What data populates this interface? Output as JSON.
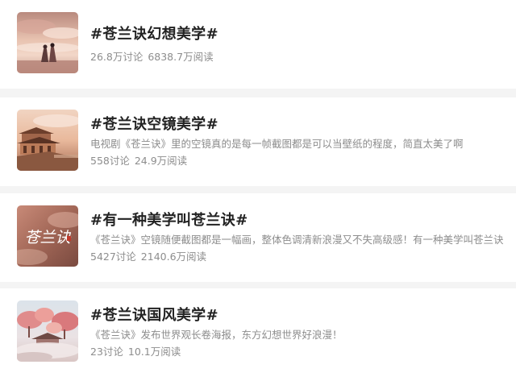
{
  "topics": [
    {
      "title": "#苍兰诀幻想美学#",
      "description": "",
      "discussions": "26.8万讨论",
      "reads": "6838.7万阅读",
      "thumbnail": "couple-under-sky-image"
    },
    {
      "title": "#苍兰诀空镜美学#",
      "description": "电视剧《苍兰诀》里的空镜真的是每一帧截图都是可以当壁纸的程度，简直太美了啊",
      "discussions": "558讨论",
      "reads": "24.9万阅读",
      "thumbnail": "palace-architecture-image"
    },
    {
      "title": "#有一种美学叫苍兰诀#",
      "description": "《苍兰诀》空镜随便截图都是一幅画，整体色调清新浪漫又不失高级感！有一种美学叫苍兰诀",
      "discussions": "5427讨论",
      "reads": "2140.6万阅读",
      "thumbnail": "calligraphy-title-image",
      "thumbnail_text": "苍兰诀"
    },
    {
      "title": "#苍兰诀国风美学#",
      "description": "《苍兰诀》发布世界观长卷海报，东方幻想世界好浪漫！",
      "discussions": "23讨论",
      "reads": "10.1万阅读",
      "thumbnail": "pink-trees-landscape-image"
    }
  ],
  "colors": {
    "background": "#f4f4f4",
    "card": "#ffffff",
    "title": "#222222",
    "meta": "#8d8d8d"
  }
}
